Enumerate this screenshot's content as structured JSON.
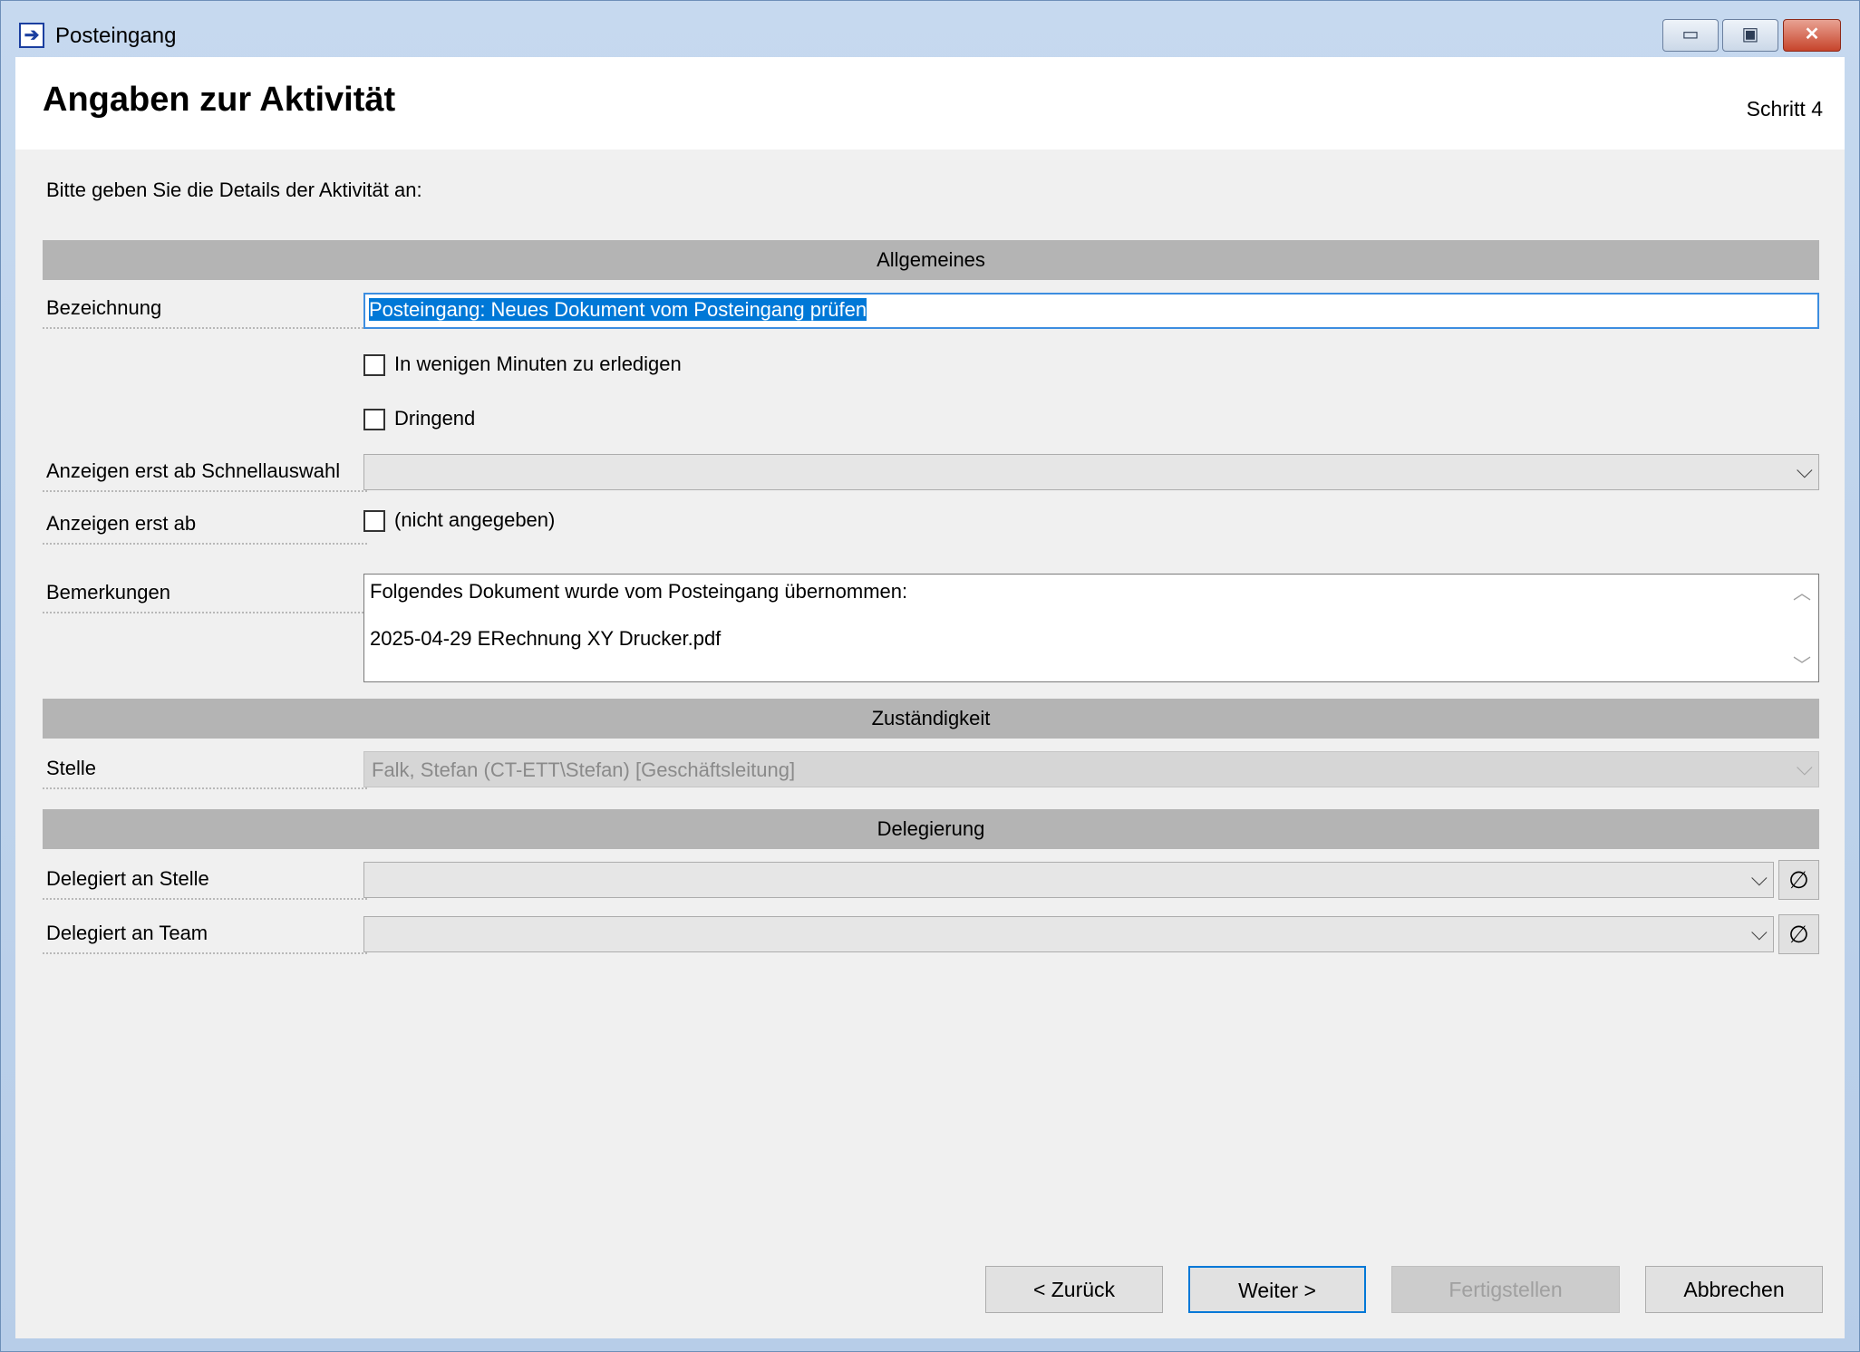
{
  "window": {
    "title": "Posteingang",
    "app_icon": "double-arrow-icon",
    "controls": {
      "minimize": "▭",
      "maximize": "▣",
      "close": "✕"
    }
  },
  "header": {
    "title": "Angaben zur Aktivität",
    "step": "Schritt 4"
  },
  "intro": "Bitte geben Sie die Details der Aktivität an:",
  "sections": {
    "allgemeines": "Allgemeines",
    "zustaendigkeit": "Zuständigkeit",
    "delegierung": "Delegierung"
  },
  "fields": {
    "bezeichnung": {
      "label": "Bezeichnung",
      "value": "Posteingang: Neues Dokument vom Posteingang prüfen"
    },
    "minuten": {
      "label": "In wenigen Minuten zu erledigen",
      "checked": false
    },
    "dringend": {
      "label": "Dringend",
      "checked": false
    },
    "schnellauswahl": {
      "label": "Anzeigen erst ab Schnellauswahl",
      "value": ""
    },
    "anzeigen_ab": {
      "label": "Anzeigen erst ab",
      "checkbox_label": "(nicht angegeben)",
      "checked": false
    },
    "bemerkungen": {
      "label": "Bemerkungen",
      "line1": "Folgendes Dokument wurde vom Posteingang übernommen:",
      "line2": "2025-04-29 ERechnung XY Drucker.pdf"
    },
    "stelle": {
      "label": "Stelle",
      "value": "Falk, Stefan (CT-ETT\\Stefan) [Geschäftsleitung]"
    },
    "delegiert_stelle": {
      "label": "Delegiert an Stelle",
      "value": ""
    },
    "delegiert_team": {
      "label": "Delegiert an Team",
      "value": ""
    }
  },
  "icons": {
    "dropdown": "⌵",
    "clear": "∅",
    "scroll_up": "︿",
    "scroll_down": "﹀"
  },
  "buttons": {
    "back": "< Zurück",
    "next": "Weiter >",
    "finish": "Fertigstellen",
    "cancel": "Abbrechen"
  }
}
